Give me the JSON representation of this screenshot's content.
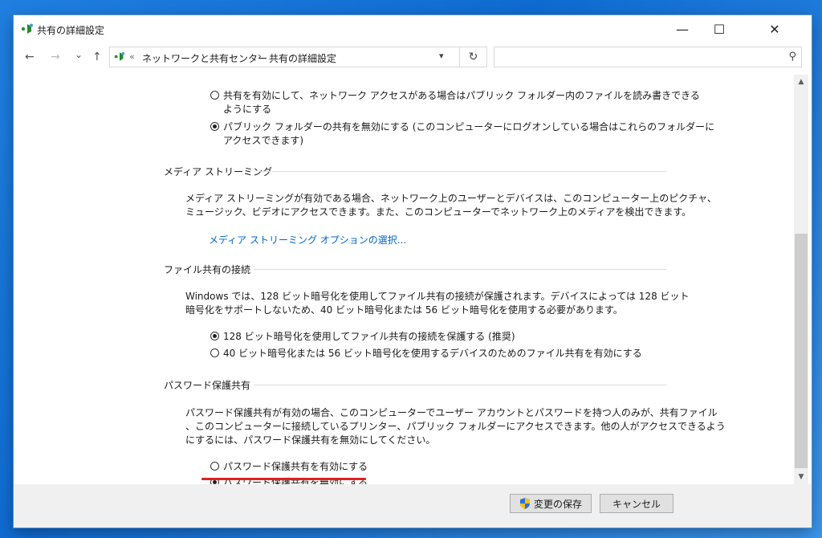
{
  "window": {
    "title": "共有の詳細設定"
  },
  "nav": {
    "back_icon": "←",
    "forward_icon": "→",
    "recent_icon": "⌄",
    "up_icon": "↑",
    "breadcrumb_chevron": "«",
    "breadcrumbs": [
      "ネットワークと共有センター",
      "共有の詳細設定"
    ],
    "separator": "›",
    "search_placeholder": ""
  },
  "public_folder": {
    "option1_line1": "共有を有効にして、ネットワーク アクセスがある場合はパブリック フォルダー内のファイルを読み書きできる",
    "option1_line2": "ようにする",
    "option2_line1": "パブリック フォルダーの共有を無効にする (このコンピューターにログオンしている場合はこれらのフォルダーに",
    "option2_line2": "アクセスできます)"
  },
  "media": {
    "heading": "メディア ストリーミング",
    "desc_line1": "メディア ストリーミングが有効である場合、ネットワーク上のユーザーとデバイスは、このコンピューター上のピクチャ、",
    "desc_line2": "ミュージック、ビデオにアクセスできます。また、このコンピューターでネットワーク上のメディアを検出できます。",
    "link": "メディア ストリーミング オプションの選択..."
  },
  "file_sharing": {
    "heading": "ファイル共有の接続",
    "desc_line1": "Windows では、128 ビット暗号化を使用してファイル共有の接続が保護されます。デバイスによっては 128 ビット",
    "desc_line2": "暗号化をサポートしないため、40 ビット暗号化または 56 ビット暗号化を使用する必要があります。",
    "option1": "128 ビット暗号化を使用してファイル共有の接続を保護する (推奨)",
    "option2": "40 ビット暗号化または 56 ビット暗号化を使用するデバイスのためのファイル共有を有効にする"
  },
  "password": {
    "heading": "パスワード保護共有",
    "desc_line1": "パスワード保護共有が有効の場合、このコンピューターでユーザー アカウントとパスワードを持つ人のみが、共有ファイル",
    "desc_line2": "、このコンピューターに接続しているプリンター、パブリック フォルダーにアクセスできます。他の人がアクセスできるよう",
    "desc_line3": "にするには、パスワード保護共有を無効にしてください。",
    "option_on": "パスワード保護共有を有効にする",
    "option_off": "パスワード保護共有を無効にする"
  },
  "footer": {
    "save": "変更の保存",
    "cancel": "キャンセル"
  },
  "colors": {
    "link": "#0066cc",
    "highlight": "#e02020"
  }
}
